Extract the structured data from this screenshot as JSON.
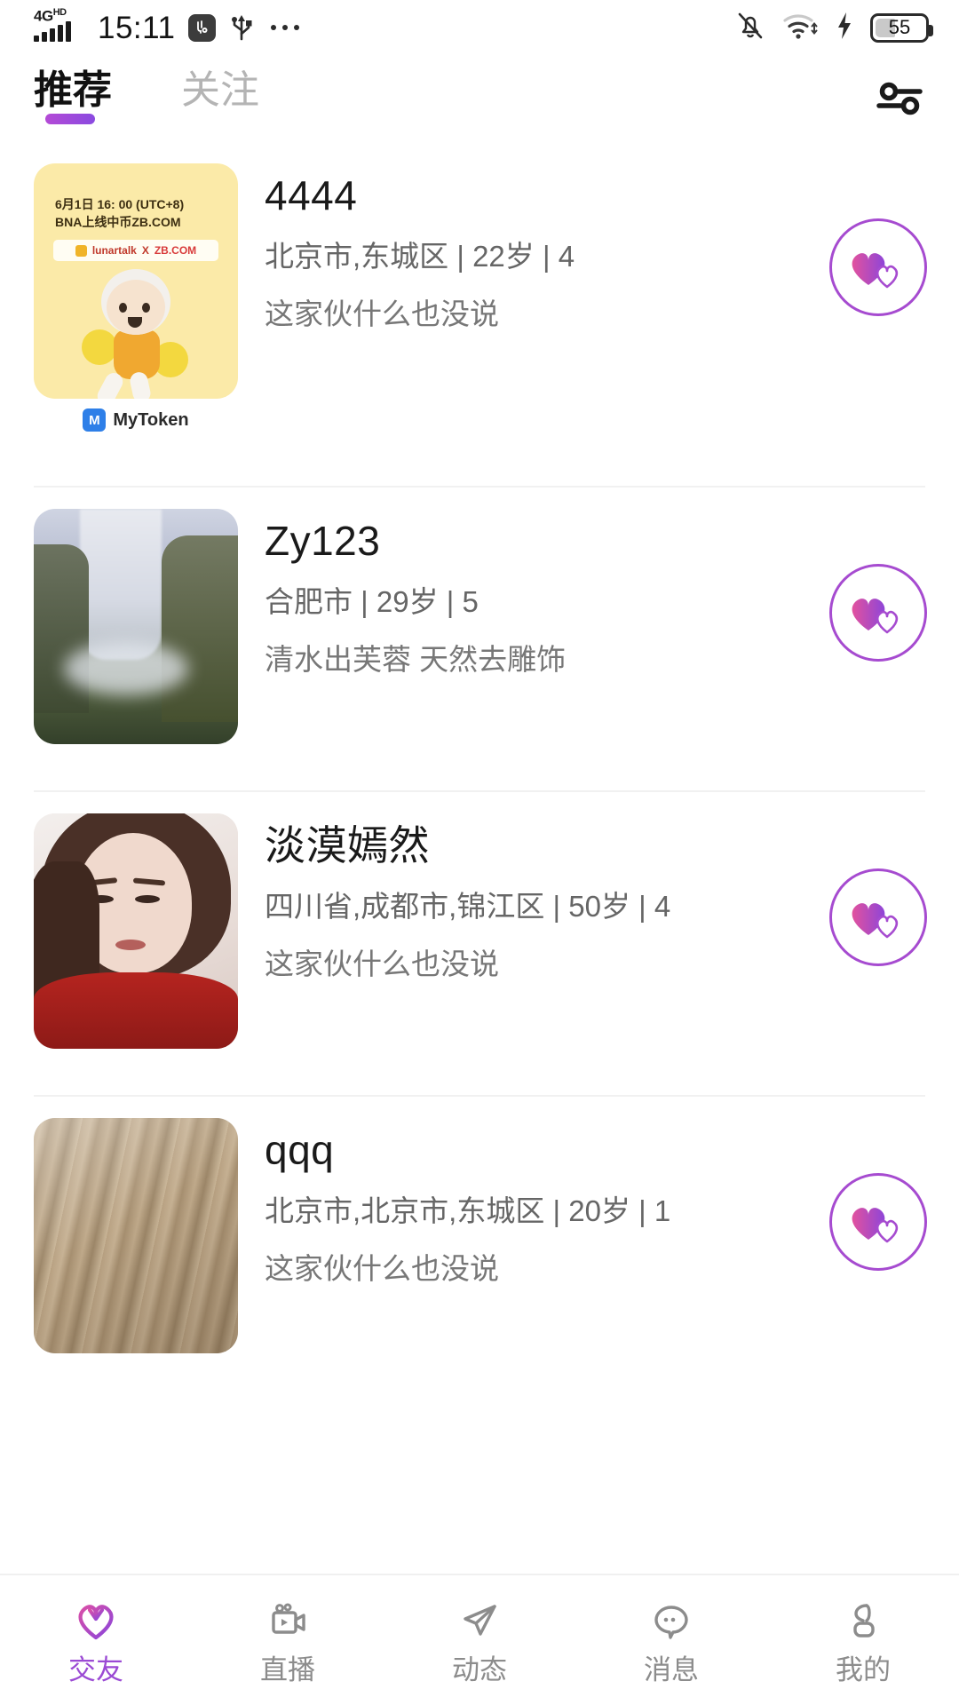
{
  "status_bar": {
    "network_type": "4G",
    "network_suffix": "HD",
    "time": "15:11",
    "battery_level": "55",
    "icons": [
      "signal-bars-icon",
      "sim-badge-icon",
      "usb-icon",
      "more-dots-icon",
      "bell-muted-icon",
      "wifi-icon",
      "charging-bolt-icon",
      "battery-icon"
    ]
  },
  "header": {
    "tabs": [
      {
        "label": "推荐",
        "active": true
      },
      {
        "label": "关注",
        "active": false
      }
    ],
    "filter_icon": "filter-sliders-icon",
    "accent_color": "#9b4ad4"
  },
  "list": {
    "like_icon": "double-heart-icon",
    "items": [
      {
        "nickname": "4444",
        "meta": "北京市,东城区 | 22岁 | 4",
        "signature": "这家伙什么也没说",
        "avatar_type": "promo-banner",
        "avatar_promo": {
          "line1": "6月1日 16: 00 (UTC+8)",
          "line2": "BNA上线中币ZB.COM",
          "chip_left": "lunartalk",
          "chip_mid": "X",
          "chip_right": "ZB.COM",
          "watermark": "MyToken",
          "watermark_mark": "M"
        }
      },
      {
        "nickname": "Zy123",
        "meta": "合肥市 | 29岁 | 5",
        "signature": "清水出芙蓉 天然去雕饰",
        "avatar_type": "waterfall-photo"
      },
      {
        "nickname": "淡漠嫣然",
        "meta": "四川省,成都市,锦江区 | 50岁 | 4",
        "signature": "这家伙什么也没说",
        "avatar_type": "portrait-photo"
      },
      {
        "nickname": "qqq",
        "meta": "北京市,北京市,东城区 | 20岁 | 1",
        "signature": "这家伙什么也没说",
        "avatar_type": "wood-photo"
      }
    ]
  },
  "bottom_nav": {
    "items": [
      {
        "label": "交友",
        "icon": "heart-icon",
        "active": true
      },
      {
        "label": "直播",
        "icon": "video-camera-icon",
        "active": false
      },
      {
        "label": "动态",
        "icon": "paper-plane-icon",
        "active": false
      },
      {
        "label": "消息",
        "icon": "chat-bubble-icon",
        "active": false
      },
      {
        "label": "我的",
        "icon": "person-icon",
        "active": false
      }
    ]
  }
}
